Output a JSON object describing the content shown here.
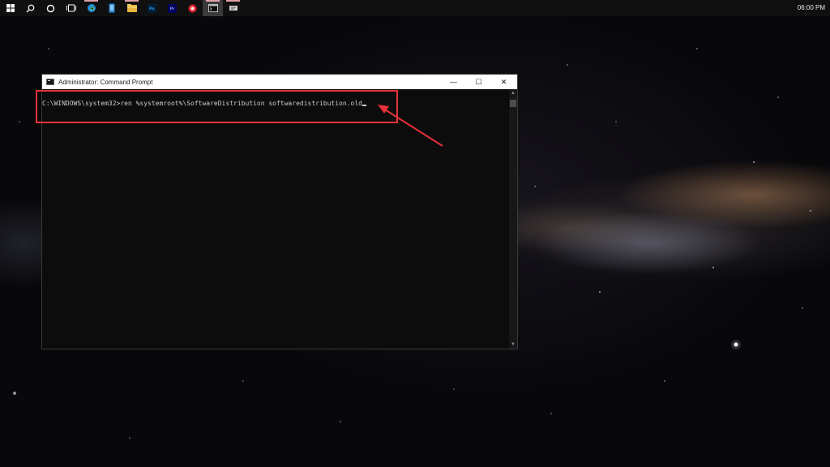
{
  "taskbar": {
    "apps": [
      {
        "name": "start-icon",
        "active": false
      },
      {
        "name": "search-icon",
        "active": false
      },
      {
        "name": "cortana-icon",
        "active": false
      },
      {
        "name": "task-view-icon",
        "active": false
      },
      {
        "name": "edge-icon",
        "active": false
      },
      {
        "name": "phone-icon",
        "active": false
      },
      {
        "name": "file-explorer-icon",
        "active": false
      },
      {
        "name": "photoshop-icon",
        "active": false
      },
      {
        "name": "premiere-icon",
        "active": false
      },
      {
        "name": "app-red-icon",
        "active": false
      },
      {
        "name": "command-prompt-icon",
        "active": true
      },
      {
        "name": "app-extra-icon",
        "active": false
      }
    ],
    "photoshop_label": "Ps",
    "premiere_label": "Pr",
    "clock": "06:00 PM"
  },
  "window": {
    "title": "Administrator: Command Prompt",
    "minimize_glyph": "—",
    "maximize_glyph": "☐",
    "close_glyph": "✕"
  },
  "console": {
    "prompt": "C:\\WINDOWS\\system32>",
    "command": "ren %systemroot%\\SoftwareDistribution softwaredistribution.old"
  },
  "colors": {
    "annotation": "#e8323a",
    "console_bg": "#0c0c0c",
    "console_text": "#cccccc"
  }
}
